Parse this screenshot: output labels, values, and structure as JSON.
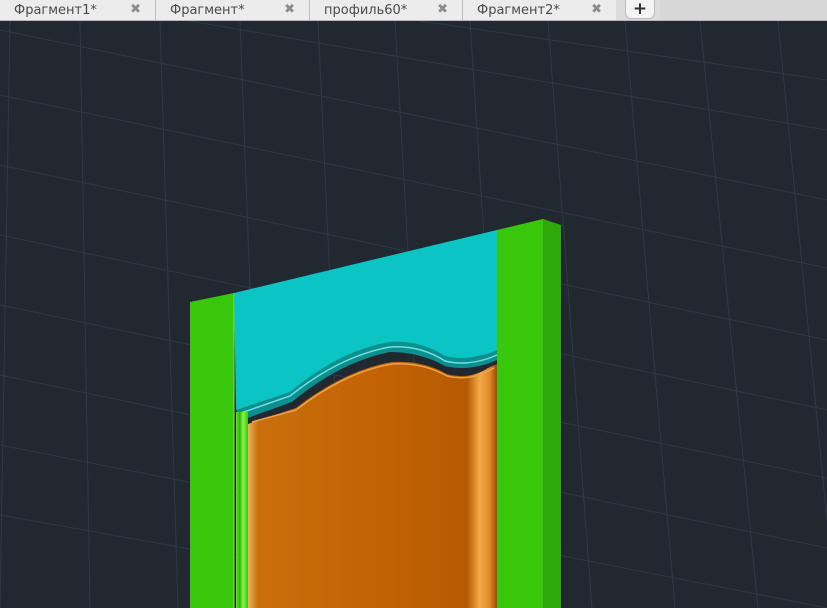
{
  "tabs": [
    {
      "label": "Фрагмент1*",
      "close": "✖"
    },
    {
      "label": "Фрагмент*",
      "close": "✖"
    },
    {
      "label": "профиль60*",
      "close": "✖"
    },
    {
      "label": "Фрагмент2*",
      "close": "✖"
    }
  ],
  "new_tab_label": "+",
  "colors": {
    "background": "#212830",
    "grid": "#2f3a46",
    "frame_green": "#39c70b",
    "frame_green_side": "#2ea90a",
    "glass_cyan": "#0bc4c4",
    "panel_orange": "#c86505",
    "panel_highlight": "#f0a24a"
  },
  "icons": {
    "close": "close-icon",
    "add": "plus-icon"
  }
}
